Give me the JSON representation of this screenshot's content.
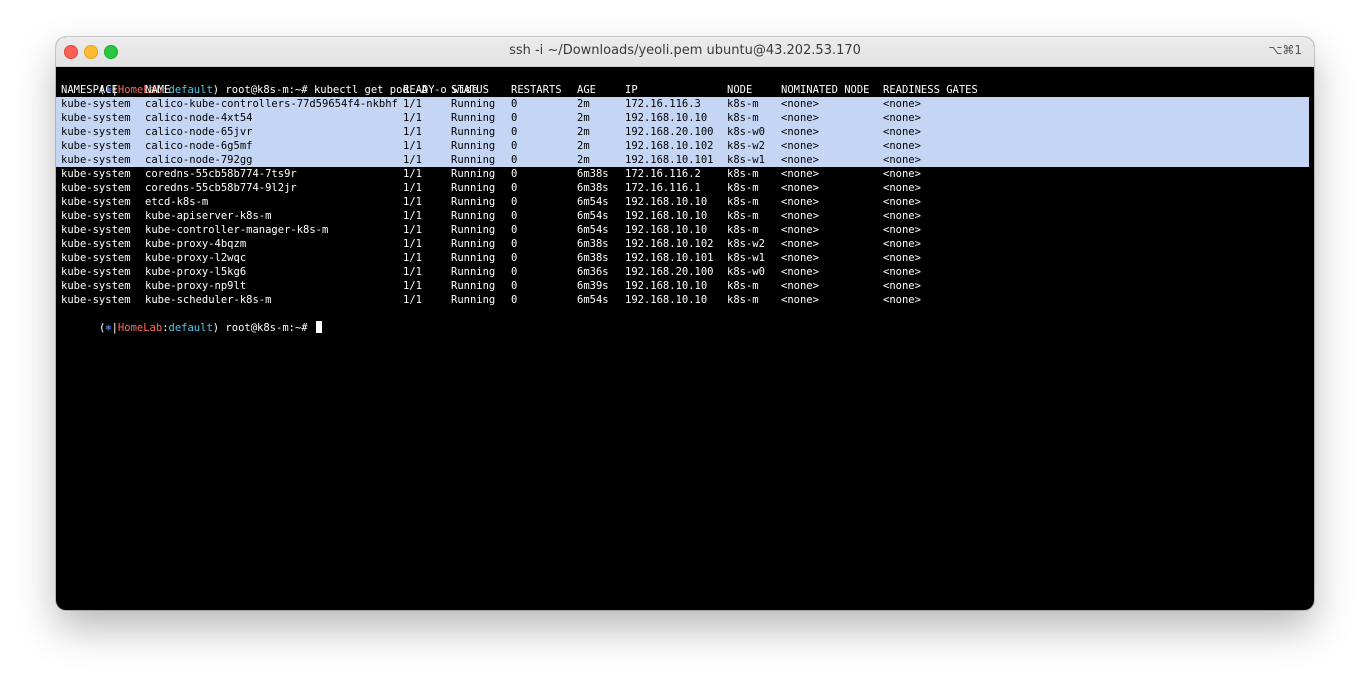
{
  "window": {
    "title": "ssh -i ~/Downloads/yeoli.pem ubuntu@43.202.53.170",
    "shortcut": "⌥⌘1"
  },
  "prompt": {
    "open": "(",
    "dot": "⎈",
    "sep1": "|",
    "context": "HomeLab",
    "sep2": ":",
    "namespace": "default",
    "close": ")",
    "user": " root@k8s-m:~# "
  },
  "command": "kubectl get pod -A -o wide",
  "table": {
    "headers": [
      "NAMESPACE",
      "NAME",
      "READY",
      "STATUS",
      "RESTARTS",
      "AGE",
      "IP",
      "NODE",
      "NOMINATED NODE",
      "READINESS GATES"
    ],
    "rows": [
      [
        "kube-system",
        "calico-kube-controllers-77d59654f4-nkbhf",
        "1/1",
        "Running",
        "0",
        "2m",
        "172.16.116.3",
        "k8s-m",
        "<none>",
        "<none>"
      ],
      [
        "kube-system",
        "calico-node-4xt54",
        "1/1",
        "Running",
        "0",
        "2m",
        "192.168.10.10",
        "k8s-m",
        "<none>",
        "<none>"
      ],
      [
        "kube-system",
        "calico-node-65jvr",
        "1/1",
        "Running",
        "0",
        "2m",
        "192.168.20.100",
        "k8s-w0",
        "<none>",
        "<none>"
      ],
      [
        "kube-system",
        "calico-node-6g5mf",
        "1/1",
        "Running",
        "0",
        "2m",
        "192.168.10.102",
        "k8s-w2",
        "<none>",
        "<none>"
      ],
      [
        "kube-system",
        "calico-node-792gg",
        "1/1",
        "Running",
        "0",
        "2m",
        "192.168.10.101",
        "k8s-w1",
        "<none>",
        "<none>"
      ],
      [
        "kube-system",
        "coredns-55cb58b774-7ts9r",
        "1/1",
        "Running",
        "0",
        "6m38s",
        "172.16.116.2",
        "k8s-m",
        "<none>",
        "<none>"
      ],
      [
        "kube-system",
        "coredns-55cb58b774-9l2jr",
        "1/1",
        "Running",
        "0",
        "6m38s",
        "172.16.116.1",
        "k8s-m",
        "<none>",
        "<none>"
      ],
      [
        "kube-system",
        "etcd-k8s-m",
        "1/1",
        "Running",
        "0",
        "6m54s",
        "192.168.10.10",
        "k8s-m",
        "<none>",
        "<none>"
      ],
      [
        "kube-system",
        "kube-apiserver-k8s-m",
        "1/1",
        "Running",
        "0",
        "6m54s",
        "192.168.10.10",
        "k8s-m",
        "<none>",
        "<none>"
      ],
      [
        "kube-system",
        "kube-controller-manager-k8s-m",
        "1/1",
        "Running",
        "0",
        "6m54s",
        "192.168.10.10",
        "k8s-m",
        "<none>",
        "<none>"
      ],
      [
        "kube-system",
        "kube-proxy-4bqzm",
        "1/1",
        "Running",
        "0",
        "6m38s",
        "192.168.10.102",
        "k8s-w2",
        "<none>",
        "<none>"
      ],
      [
        "kube-system",
        "kube-proxy-l2wqc",
        "1/1",
        "Running",
        "0",
        "6m38s",
        "192.168.10.101",
        "k8s-w1",
        "<none>",
        "<none>"
      ],
      [
        "kube-system",
        "kube-proxy-l5kg6",
        "1/1",
        "Running",
        "0",
        "6m36s",
        "192.168.20.100",
        "k8s-w0",
        "<none>",
        "<none>"
      ],
      [
        "kube-system",
        "kube-proxy-np9lt",
        "1/1",
        "Running",
        "0",
        "6m39s",
        "192.168.10.10",
        "k8s-m",
        "<none>",
        "<none>"
      ],
      [
        "kube-system",
        "kube-scheduler-k8s-m",
        "1/1",
        "Running",
        "0",
        "6m54s",
        "192.168.10.10",
        "k8s-m",
        "<none>",
        "<none>"
      ]
    ],
    "selected_row_count": 5
  },
  "colors": {
    "selection": "#c5d6f5",
    "context": "#ff6b5e",
    "namespace": "#4ec9e8",
    "dot": "#5f8fff"
  }
}
